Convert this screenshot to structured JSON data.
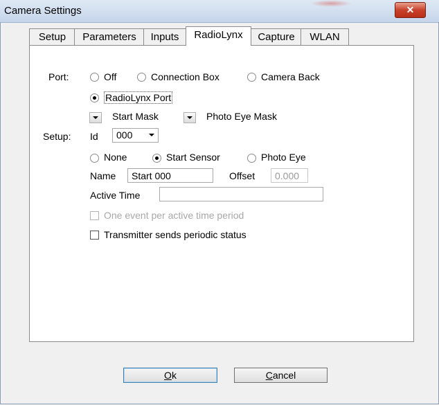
{
  "window": {
    "title": "Camera Settings",
    "close_glyph": "✕"
  },
  "tabs": [
    {
      "label": "Setup"
    },
    {
      "label": "Parameters"
    },
    {
      "label": "Inputs"
    },
    {
      "label": "RadioLynx"
    },
    {
      "label": "Capture"
    },
    {
      "label": "WLAN"
    }
  ],
  "active_tab": "RadioLynx",
  "port": {
    "label": "Port:",
    "options": [
      {
        "label": "Off",
        "selected": false
      },
      {
        "label": "Connection Box",
        "selected": false
      },
      {
        "label": "Camera Back",
        "selected": false
      },
      {
        "label": "RadioLynx Port",
        "selected": true
      }
    ]
  },
  "masks": {
    "start_mask": "Start Mask",
    "photo_eye_mask": "Photo Eye Mask"
  },
  "setup": {
    "label": "Setup:",
    "id_label": "Id",
    "id_value": "000",
    "type_options": [
      {
        "label": "None",
        "selected": false
      },
      {
        "label": "Start Sensor",
        "selected": true
      },
      {
        "label": "Photo Eye",
        "selected": false
      }
    ],
    "name_label": "Name",
    "name_value": "Start 000",
    "offset_label": "Offset",
    "offset_value": "0.000",
    "active_time_label": "Active Time",
    "active_time_value": "",
    "one_event_label": "One event per active time period",
    "transmitter_label": "Transmitter sends periodic status"
  },
  "buttons": {
    "ok_label": "Ok",
    "ok_mnemonic": "O",
    "ok_rest": "k",
    "cancel_mnemonic": "C",
    "cancel_rest": "ancel"
  },
  "colors": {
    "close_button": "#c8412b",
    "title_bar": "#dfe9f5"
  }
}
